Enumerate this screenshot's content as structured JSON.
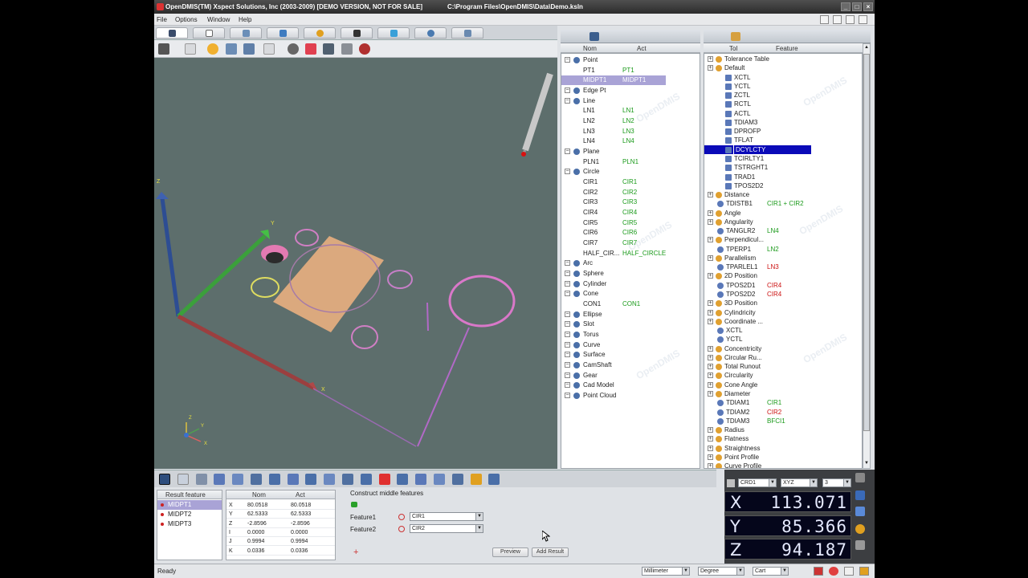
{
  "window": {
    "title": "OpenDMIS(TM) Xspect Solutions, Inc (2003-2009) [DEMO VERSION, NOT FOR SALE]",
    "path": "C:\\Program Files\\OpenDMIS\\Data\\Demo.ksln"
  },
  "menu": [
    "File",
    "Options",
    "Window",
    "Help"
  ],
  "viewport_labels": {
    "z": "Z",
    "y": "Y",
    "x": "X",
    "triad_z": "Z",
    "triad_y": "Y",
    "triad_x": "X"
  },
  "feature_panel": {
    "col_nom": "Nom",
    "col_act": "Act",
    "rows": [
      {
        "type": "group",
        "nom": "Point",
        "act": "",
        "indent": 0
      },
      {
        "type": "item",
        "nom": "PT1",
        "act": "PT1",
        "indent": 1
      },
      {
        "type": "item",
        "nom": "MIDPT1",
        "act": "MIDPT1",
        "indent": 1,
        "selected": true
      },
      {
        "type": "group",
        "nom": "Edge Pt",
        "act": "",
        "indent": 0
      },
      {
        "type": "group",
        "nom": "Line",
        "act": "",
        "indent": 0
      },
      {
        "type": "item",
        "nom": "LN1",
        "act": "LN1",
        "indent": 1
      },
      {
        "type": "item",
        "nom": "LN2",
        "act": "LN2",
        "indent": 1
      },
      {
        "type": "item",
        "nom": "LN3",
        "act": "LN3",
        "indent": 1
      },
      {
        "type": "item",
        "nom": "LN4",
        "act": "LN4",
        "indent": 1
      },
      {
        "type": "group",
        "nom": "Plane",
        "act": "",
        "indent": 0
      },
      {
        "type": "item",
        "nom": "PLN1",
        "act": "PLN1",
        "indent": 1
      },
      {
        "type": "group",
        "nom": "Circle",
        "act": "",
        "indent": 0
      },
      {
        "type": "item",
        "nom": "CIR1",
        "act": "CIR1",
        "indent": 1
      },
      {
        "type": "item",
        "nom": "CIR2",
        "act": "CIR2",
        "indent": 1
      },
      {
        "type": "item",
        "nom": "CIR3",
        "act": "CIR3",
        "indent": 1
      },
      {
        "type": "item",
        "nom": "CIR4",
        "act": "CIR4",
        "indent": 1
      },
      {
        "type": "item",
        "nom": "CIR5",
        "act": "CIR5",
        "indent": 1
      },
      {
        "type": "item",
        "nom": "CIR6",
        "act": "CIR6",
        "indent": 1
      },
      {
        "type": "item",
        "nom": "CIR7",
        "act": "CIR7",
        "indent": 1
      },
      {
        "type": "item",
        "nom": "HALF_CIR...",
        "act": "HALF_CIRCLE",
        "indent": 1
      },
      {
        "type": "group",
        "nom": "Arc",
        "act": "",
        "indent": 0
      },
      {
        "type": "group",
        "nom": "Sphere",
        "act": "",
        "indent": 0
      },
      {
        "type": "group",
        "nom": "Cylinder",
        "act": "",
        "indent": 0
      },
      {
        "type": "group",
        "nom": "Cone",
        "act": "",
        "indent": 0
      },
      {
        "type": "item",
        "nom": "CON1",
        "act": "CON1",
        "indent": 1
      },
      {
        "type": "group",
        "nom": "Ellipse",
        "act": "",
        "indent": 0
      },
      {
        "type": "group",
        "nom": "Slot",
        "act": "",
        "indent": 0
      },
      {
        "type": "group",
        "nom": "Torus",
        "act": "",
        "indent": 0
      },
      {
        "type": "group",
        "nom": "Curve",
        "act": "",
        "indent": 0
      },
      {
        "type": "group",
        "nom": "Surface",
        "act": "",
        "indent": 0
      },
      {
        "type": "group",
        "nom": "CamShaft",
        "act": "",
        "indent": 0
      },
      {
        "type": "group",
        "nom": "Gear",
        "act": "",
        "indent": 0
      },
      {
        "type": "group",
        "nom": "Cad Model",
        "act": "",
        "indent": 0
      },
      {
        "type": "group",
        "nom": "Point Cloud",
        "act": "",
        "indent": 0
      }
    ]
  },
  "tol_panel": {
    "col_tol": "Tol",
    "col_feature": "Feature",
    "rows": [
      {
        "nom": "Tolerance Table",
        "feat": "",
        "indent": 0,
        "color": ""
      },
      {
        "nom": "Default",
        "feat": "",
        "indent": 0,
        "color": ""
      },
      {
        "nom": "XCTL",
        "feat": "",
        "indent": 2,
        "color": ""
      },
      {
        "nom": "YCTL",
        "feat": "",
        "indent": 2,
        "color": ""
      },
      {
        "nom": "ZCTL",
        "feat": "",
        "indent": 2,
        "color": ""
      },
      {
        "nom": "RCTL",
        "feat": "",
        "indent": 2,
        "color": ""
      },
      {
        "nom": "ACTL",
        "feat": "",
        "indent": 2,
        "color": ""
      },
      {
        "nom": "TDIAM3",
        "feat": "",
        "indent": 2,
        "color": ""
      },
      {
        "nom": "DPROFP",
        "feat": "",
        "indent": 2,
        "color": ""
      },
      {
        "nom": "TFLAT",
        "feat": "",
        "indent": 2,
        "color": ""
      },
      {
        "nom": "DCYLCTY",
        "feat": "",
        "indent": 2,
        "color": "",
        "selected": true
      },
      {
        "nom": "TCIRLTY1",
        "feat": "",
        "indent": 2,
        "color": ""
      },
      {
        "nom": "TSTRGHT1",
        "feat": "",
        "indent": 2,
        "color": ""
      },
      {
        "nom": "TRAD1",
        "feat": "",
        "indent": 2,
        "color": ""
      },
      {
        "nom": "TPOS2D2",
        "feat": "",
        "indent": 2,
        "color": ""
      },
      {
        "nom": "Distance",
        "feat": "",
        "indent": 0,
        "color": ""
      },
      {
        "nom": "TDISTB1",
        "feat": "CIR1 + CIR2",
        "indent": 1,
        "color": "green"
      },
      {
        "nom": "Angle",
        "feat": "",
        "indent": 0,
        "color": ""
      },
      {
        "nom": "Angularity",
        "feat": "",
        "indent": 0,
        "color": ""
      },
      {
        "nom": "TANGLR2",
        "feat": "LN4",
        "indent": 1,
        "color": "green"
      },
      {
        "nom": "Perpendicul...",
        "feat": "",
        "indent": 0,
        "color": ""
      },
      {
        "nom": "TPERP1",
        "feat": "LN2",
        "indent": 1,
        "color": "green"
      },
      {
        "nom": "Parallelism",
        "feat": "",
        "indent": 0,
        "color": ""
      },
      {
        "nom": "TPARLEL1",
        "feat": "LN3",
        "indent": 1,
        "color": "red"
      },
      {
        "nom": "2D Position",
        "feat": "",
        "indent": 0,
        "color": ""
      },
      {
        "nom": "TPOS2D1",
        "feat": "CIR4",
        "indent": 1,
        "color": "red"
      },
      {
        "nom": "TPOS2D2",
        "feat": "CIR4",
        "indent": 1,
        "color": "red"
      },
      {
        "nom": "3D Position",
        "feat": "",
        "indent": 0,
        "color": ""
      },
      {
        "nom": "Cylindricity",
        "feat": "",
        "indent": 0,
        "color": ""
      },
      {
        "nom": "Coordinate ...",
        "feat": "",
        "indent": 0,
        "color": ""
      },
      {
        "nom": "XCTL",
        "feat": "",
        "indent": 1,
        "color": ""
      },
      {
        "nom": "YCTL",
        "feat": "",
        "indent": 1,
        "color": ""
      },
      {
        "nom": "Concentricity",
        "feat": "",
        "indent": 0,
        "color": ""
      },
      {
        "nom": "Circular Ru...",
        "feat": "",
        "indent": 0,
        "color": ""
      },
      {
        "nom": "Total Runout",
        "feat": "",
        "indent": 0,
        "color": ""
      },
      {
        "nom": "Circularity",
        "feat": "",
        "indent": 0,
        "color": ""
      },
      {
        "nom": "Cone Angle",
        "feat": "",
        "indent": 0,
        "color": ""
      },
      {
        "nom": "Diameter",
        "feat": "",
        "indent": 0,
        "color": ""
      },
      {
        "nom": "TDIAM1",
        "feat": "CIR1",
        "indent": 1,
        "color": "green"
      },
      {
        "nom": "TDIAM2",
        "feat": "CIR2",
        "indent": 1,
        "color": "red"
      },
      {
        "nom": "TDIAM3",
        "feat": "BFCI1",
        "indent": 1,
        "color": "green"
      },
      {
        "nom": "Radius",
        "feat": "",
        "indent": 0,
        "color": ""
      },
      {
        "nom": "Flatness",
        "feat": "",
        "indent": 0,
        "color": ""
      },
      {
        "nom": "Straightness",
        "feat": "",
        "indent": 0,
        "color": ""
      },
      {
        "nom": "Point Profile",
        "feat": "",
        "indent": 0,
        "color": ""
      },
      {
        "nom": "Curve Profile",
        "feat": "",
        "indent": 0,
        "color": ""
      }
    ]
  },
  "result_panel": {
    "header": "Result feature",
    "items": [
      "MIDPT1",
      "MIDPT2",
      "MIDPT3"
    ]
  },
  "values_table": {
    "col_nom": "Nom",
    "col_act": "Act",
    "rows": [
      {
        "axis": "X",
        "nom": "80.0518",
        "act": "80.0518"
      },
      {
        "axis": "Y",
        "nom": "62.5333",
        "act": "62.5333"
      },
      {
        "axis": "Z",
        "nom": "-2.8596",
        "act": "-2.8596"
      },
      {
        "axis": "I",
        "nom": "0.0000",
        "act": "0.0000"
      },
      {
        "axis": "J",
        "nom": "0.9994",
        "act": "0.9994"
      },
      {
        "axis": "K",
        "nom": "0.0336",
        "act": "0.0336"
      }
    ]
  },
  "construct": {
    "title": "Construct middle features",
    "feature1_label": "Feature1",
    "feature1_value": "CIR1",
    "feature2_label": "Feature2",
    "feature2_value": "CIR2",
    "preview_label": "Preview",
    "add_result_label": "Add Result"
  },
  "dro": {
    "coord_system": "CRD1",
    "plane": "XYZ",
    "decimals": "3",
    "values": [
      {
        "axis": "X",
        "value": "113.071"
      },
      {
        "axis": "Y",
        "value": "85.366"
      },
      {
        "axis": "Z",
        "value": "94.187"
      }
    ]
  },
  "status": {
    "text": "Ready",
    "units": "Millimeter",
    "angle": "Degree",
    "coord": "Cart"
  },
  "colors": {
    "viewport_bg": "#5d6e6c",
    "selected_blue": "#0a0ab8",
    "act_green": "#1a9a1a",
    "act_red": "#cc1111",
    "dro_bg": "#05061b"
  }
}
